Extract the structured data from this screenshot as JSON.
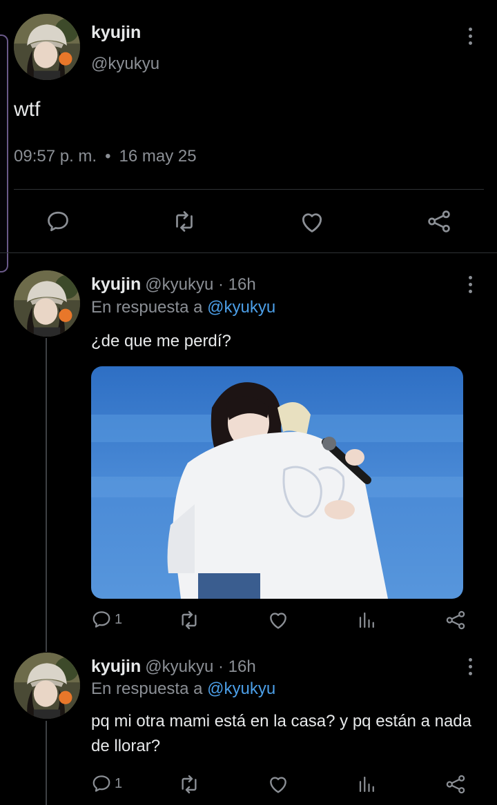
{
  "main_tweet": {
    "author_name": "kyujin",
    "author_handle": "@kyukyu",
    "text": "wtf",
    "time": "09:57 p. m.",
    "separator": "•",
    "date": "16 may 25",
    "avatar_icon": "avatar-photo",
    "actions": [
      "reply-icon",
      "retweet-icon",
      "like-icon",
      "share-icon"
    ]
  },
  "replies": [
    {
      "author_name": "kyujin",
      "author_handle_time": "@kyukyu · 16h",
      "reply_label": "En respuesta a",
      "reply_mention": "@kyukyu",
      "text": "¿de que me perdí?",
      "reply_count": "1",
      "has_media": true
    },
    {
      "author_name": "kyujin",
      "author_handle_time": "@kyukyu · 16h",
      "reply_label": "En respuesta a",
      "reply_mention": "@kyukyu",
      "text": "pq mi otra mami está en la casa? y pq están a nada de llorar?",
      "reply_count": "1",
      "has_media": false
    }
  ],
  "colors": {
    "background": "#000000",
    "text": "#e7e9ea",
    "secondary": "#8b8f95",
    "mention": "#4c9fe8",
    "divider": "#2f3336"
  }
}
